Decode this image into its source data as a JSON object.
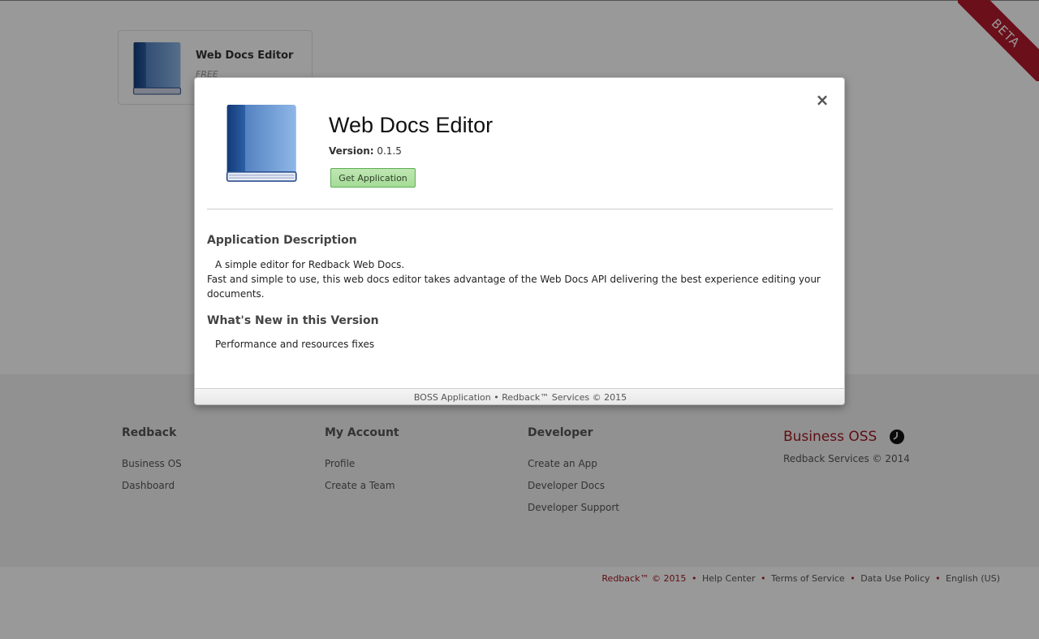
{
  "app_card": {
    "name": "Web Docs Editor",
    "price": "FREE",
    "icon": "book-icon"
  },
  "ribbon": {
    "label": "BETA"
  },
  "modal": {
    "title": "Web Docs Editor",
    "version_label": "Version:",
    "version_value": "0.1.5",
    "get_button": "Get Application",
    "close_label": "×",
    "icon": "book-icon",
    "description_heading": "Application Description",
    "description_line1": "A simple editor for Redback Web Docs.",
    "description_line2": "Fast and simple to use, this web docs editor takes advantage of the Web Docs API delivering the best experience editing your documents.",
    "whats_new_heading": "What's New in this Version",
    "whats_new_text": "Performance and resources fixes",
    "footer_text": "BOSS Application • Redback™ Services © 2015"
  },
  "footer": {
    "columns": [
      {
        "title": "Redback",
        "links": [
          "Business OS",
          "Dashboard"
        ]
      },
      {
        "title": "My Account",
        "links": [
          "Profile",
          "Create a Team"
        ]
      },
      {
        "title": "Developer",
        "links": [
          "Create an App",
          "Developer Docs",
          "Developer Support"
        ]
      }
    ],
    "brand": {
      "name": "Business OSS",
      "icon": "clock-icon",
      "copyright": "Redback Services © 2014"
    }
  },
  "bottom_bar": {
    "copyright": "Redback™ © 2015",
    "separator": "•",
    "links": [
      "Help Center",
      "Terms of Service",
      "Data Use Policy",
      "English (US)"
    ]
  },
  "colors": {
    "brand_red": "#a01a24",
    "ribbon_red": "#b31b2d",
    "button_green": "#a5dc96"
  }
}
